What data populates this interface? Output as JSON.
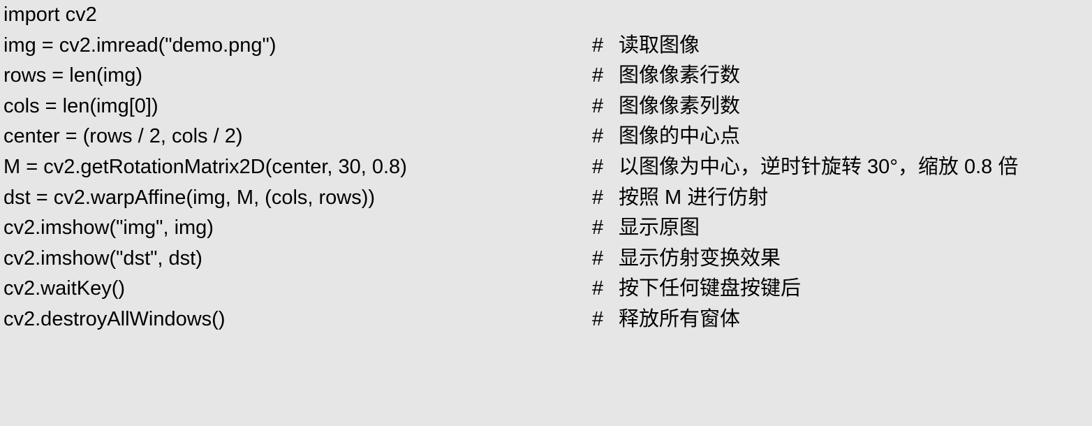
{
  "lines": [
    {
      "code": "import cv2",
      "comment": ""
    },
    {
      "code": "img = cv2.imread(\"demo.png\")",
      "comment": "读取图像"
    },
    {
      "code": "rows = len(img)",
      "comment": "图像像素行数"
    },
    {
      "code": "cols = len(img[0])",
      "comment": "图像像素列数"
    },
    {
      "code": "center = (rows / 2, cols / 2)",
      "comment": "图像的中心点"
    },
    {
      "code": "M = cv2.getRotationMatrix2D(center, 30, 0.8)",
      "comment": "以图像为中心，逆时针旋转 30°，缩放 0.8 倍"
    },
    {
      "code": "dst = cv2.warpAffine(img, M, (cols, rows))",
      "comment": "按照 M 进行仿射"
    },
    {
      "code": "cv2.imshow(\"img\", img)",
      "comment": "显示原图"
    },
    {
      "code": "cv2.imshow(\"dst\", dst)",
      "comment": "显示仿射变换效果"
    },
    {
      "code": "cv2.waitKey()",
      "comment": "按下任何键盘按键后"
    },
    {
      "code": "cv2.destroyAllWindows()",
      "comment": "释放所有窗体"
    }
  ],
  "comment_marker": "#"
}
